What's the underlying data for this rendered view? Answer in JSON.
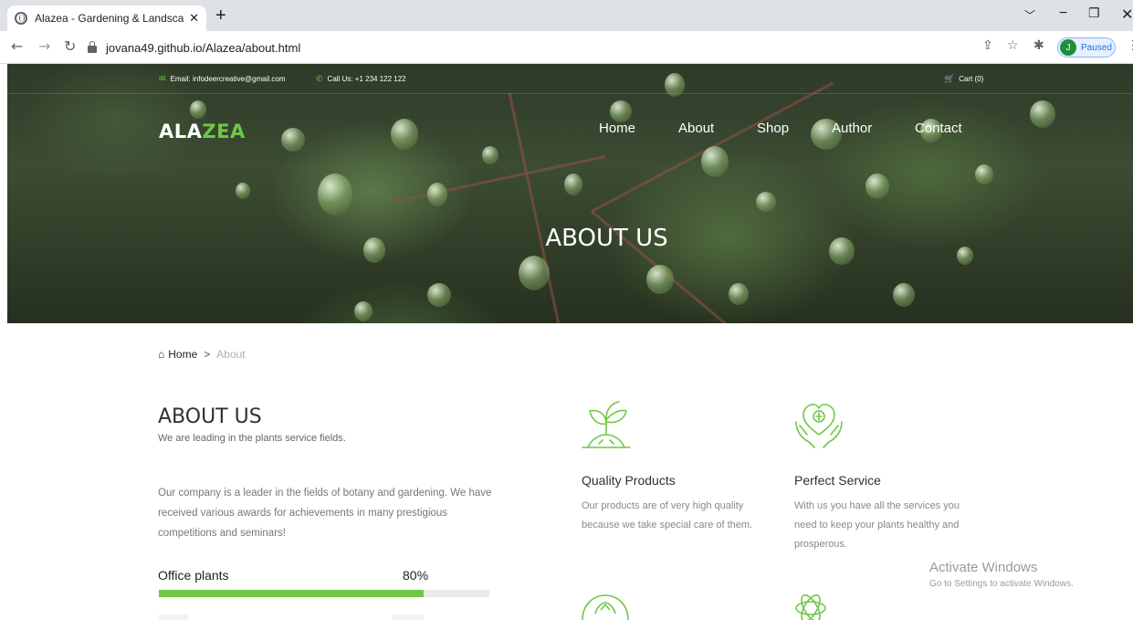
{
  "browser": {
    "tab_title": "Alazea - Gardening & Landscapin",
    "tab_close": "✕",
    "new_tab": "+",
    "url": "jovana49.github.io/Alazea/about.html",
    "profile_initial": "J",
    "profile_label": "Paused",
    "icons": [
      "back-icon",
      "forward-icon",
      "reload-icon",
      "lock-icon",
      "share-icon",
      "star-icon",
      "extensions-icon",
      "menu-icon"
    ]
  },
  "topbar": {
    "email": "Email: infodeercreative@gmail.com",
    "phone": "Call Us: +1 234 122 122",
    "cart": "Cart (0)"
  },
  "header": {
    "logo_main": "ALA",
    "logo_accent": "ZEA",
    "nav": [
      "Home",
      "About",
      "Shop",
      "Author",
      "Contact"
    ]
  },
  "hero": {
    "title": "ABOUT US"
  },
  "breadcrumb": {
    "home": "Home",
    "separator": ">",
    "current": "About"
  },
  "about": {
    "heading": "ABOUT US",
    "subheading": "We are leading in the plants service fields.",
    "paragraph": "Our company is a leader in the fields of botany and gardening. We have received various awards for achievements in many prestigious competitions and seminars!"
  },
  "progress": [
    {
      "label": "Office plants",
      "percent_label": "80%",
      "value": 0.8
    }
  ],
  "features": [
    {
      "title": "Quality Products",
      "text": "Our products are of very high quality because we take special care of them.",
      "icon": "sprout-icon"
    },
    {
      "title": "Perfect Service",
      "text": "With us you have all the services you need to keep your plants healthy and prosperous.",
      "icon": "heart-hands-icon"
    }
  ],
  "watermark": {
    "line1": "Activate Windows",
    "line2": "Go to Settings to activate Windows."
  },
  "colors": {
    "accent": "#70c745",
    "track": "#ebebeb"
  }
}
